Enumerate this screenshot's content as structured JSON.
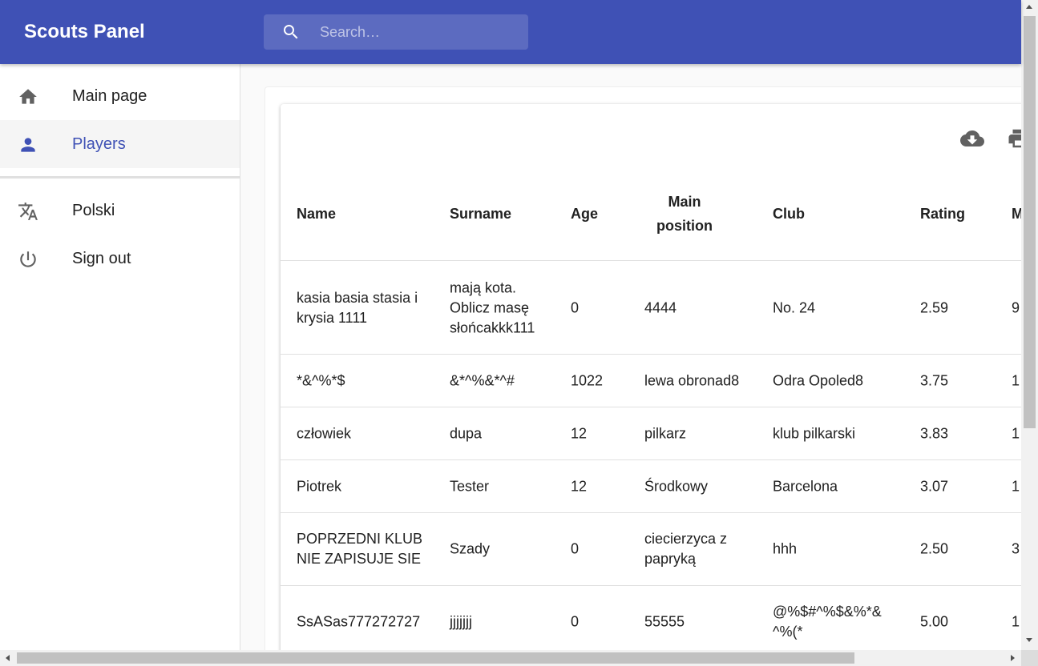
{
  "app": {
    "title": "Scouts Panel"
  },
  "search": {
    "placeholder": "Search…",
    "icon": "search-icon"
  },
  "colors": {
    "primary": "#3f51b5",
    "search_bg": "#5c6bc0",
    "active_bg": "#f5f5f5"
  },
  "sidebar": {
    "items": [
      {
        "label": "Main page",
        "icon": "home-icon"
      },
      {
        "label": "Players",
        "icon": "person-icon",
        "active": true
      },
      {
        "label": "Polski",
        "icon": "translate-icon"
      },
      {
        "label": "Sign out",
        "icon": "power-icon"
      }
    ]
  },
  "toolbar": {
    "download_icon": "cloud-download-icon",
    "print_icon": "print-icon"
  },
  "table": {
    "columns": [
      "Name",
      "Surname",
      "Age",
      "Main position",
      "Club",
      "Rating",
      "M"
    ],
    "rows": [
      [
        "kasia basia stasia i krysia 1111",
        "mają kota. Oblicz masę słońcakkk111",
        "0",
        "4444",
        "No. 24",
        "2.59",
        "9"
      ],
      [
        "*&^%*$",
        "&*^%&*^#",
        "1022",
        "lewa obronad8",
        "Odra Opoled8",
        "3.75",
        "1"
      ],
      [
        "człowiek",
        "dupa",
        "12",
        "pilkarz",
        "klub pilkarski",
        "3.83",
        "1"
      ],
      [
        "Piotrek",
        "Tester",
        "12",
        "Środkowy",
        "Barcelona",
        "3.07",
        "1"
      ],
      [
        "POPRZEDNI KLUB NIE ZAPISUJE SIE",
        "Szady",
        "0",
        "ciecierzyca z papryką",
        "hhh",
        "2.50",
        "3"
      ],
      [
        "SsASas777272727",
        "jjjjjjj",
        "0",
        "55555",
        "@%$#^%$&%*&^%(*",
        "5.00",
        "1"
      ]
    ]
  }
}
